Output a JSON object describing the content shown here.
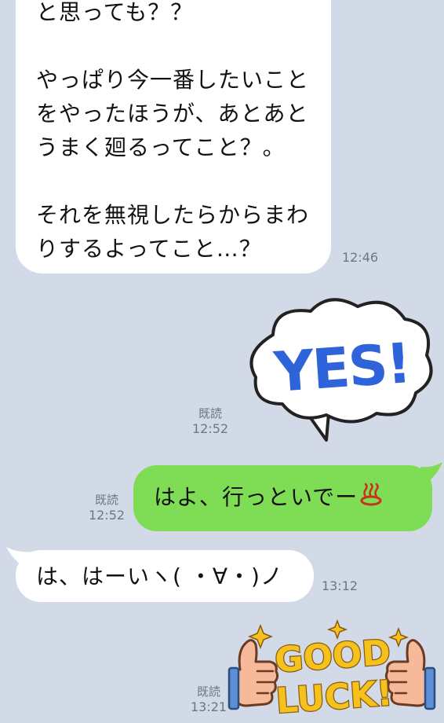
{
  "messages": [
    {
      "side": "in",
      "paragraphs": [
        "と思っても？？",
        "やっぱり今一番したいことをやったほうが、あとあとうまく廻るってこと？。",
        "それを無視したらからまわりするよってこと…？"
      ],
      "time": "12:46"
    },
    {
      "side": "out",
      "type": "sticker",
      "sticker_text": "YES!",
      "read": "既読",
      "time": "12:52"
    },
    {
      "side": "out",
      "text": "はよ、行っといでー",
      "emoji": "hot-spring-icon",
      "read": "既読",
      "time": "12:52"
    },
    {
      "side": "in",
      "text": "は、はーいヽ( ・∀・)ノ",
      "time": "13:12"
    },
    {
      "side": "out",
      "type": "sticker",
      "sticker_text_line1": "GOOD",
      "sticker_text_line2": "LUCK!",
      "read": "既読",
      "time": "13:21"
    }
  ],
  "colors": {
    "background": "#d1dae6",
    "incoming_bubble": "#ffffff",
    "outgoing_bubble": "#7fdc55",
    "yes_text": "#2f63d9",
    "goodluck_text": "#f5c21d"
  }
}
